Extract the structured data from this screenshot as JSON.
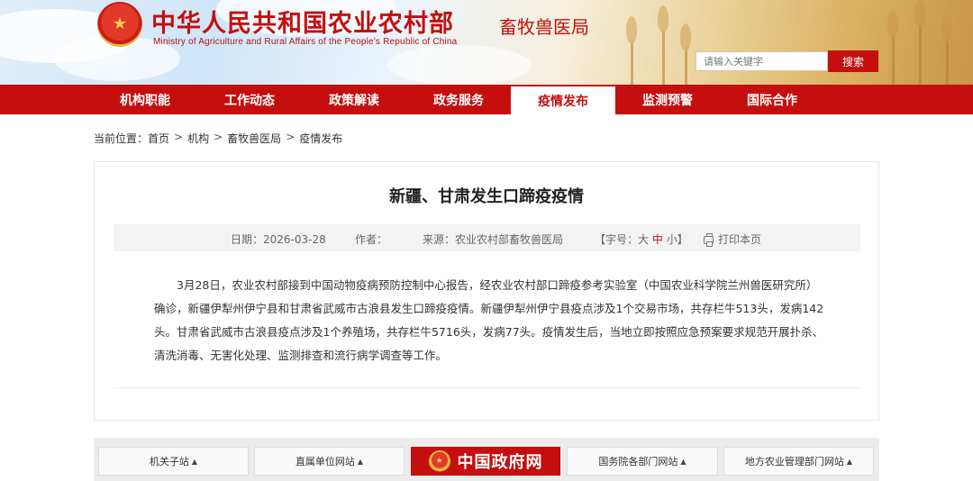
{
  "header": {
    "site_title": "中华人民共和国农业农村部",
    "site_subtitle": "Ministry of Agriculture and Rural Affairs of the People's Republic of China",
    "dept_name": "畜牧兽医局",
    "search_placeholder": "请输入关键字",
    "search_button": "搜索"
  },
  "nav": {
    "items": [
      {
        "label": "机构职能"
      },
      {
        "label": "工作动态"
      },
      {
        "label": "政策解读"
      },
      {
        "label": "政务服务"
      },
      {
        "label": "疫情发布",
        "active": true
      },
      {
        "label": "监测预警"
      },
      {
        "label": "国际合作"
      }
    ]
  },
  "breadcrumb": {
    "prefix": "当前位置：",
    "items": [
      "首页",
      "机构",
      "畜牧兽医局",
      "疫情发布"
    ],
    "separator": ">"
  },
  "article": {
    "title": "新疆、甘肃发生口蹄疫疫情",
    "meta": {
      "date": "日期：2026-03-28",
      "author": "作者：",
      "source": "来源：农业农村部畜牧兽医局",
      "font_size_prefix": "【字号：",
      "font_large": "大",
      "font_medium": "中",
      "font_small": "小",
      "font_size_suffix": "】",
      "print": "打印本页"
    },
    "body": "3月28日，农业农村部接到中国动物疫病预防控制中心报告，经农业农村部口蹄疫参考实验室（中国农业科学院兰州兽医研究所）确诊，新疆伊犁州伊宁县和甘肃省武威市古浪县发生口蹄疫疫情。新疆伊犁州伊宁县疫点涉及1个交易市场，共存栏牛513头，发病142头。甘肃省武威市古浪县疫点涉及1个养殖场，共存栏牛5716头，发病77头。疫情发生后，当地立即按照应急预案要求规范开展扑杀、清洗消毒、无害化处理、监测排查和流行病学调查等工作。"
  },
  "footer": {
    "links": [
      {
        "label": "机关子站",
        "caret": "▲"
      },
      {
        "label": "直属单位网站",
        "caret": "▲"
      },
      {
        "label": "国务院各部门网站",
        "caret": "▲"
      },
      {
        "label": "地方农业管理部门网站",
        "caret": "▲"
      }
    ],
    "gov_banner": "中国政府网"
  },
  "colors": {
    "brand_red": "#c50e0e",
    "meta_bg": "#f3f3f3"
  },
  "icons": {
    "emblem": "national-emblem-icon",
    "print": "printer-icon",
    "caret": "caret-up-icon"
  }
}
